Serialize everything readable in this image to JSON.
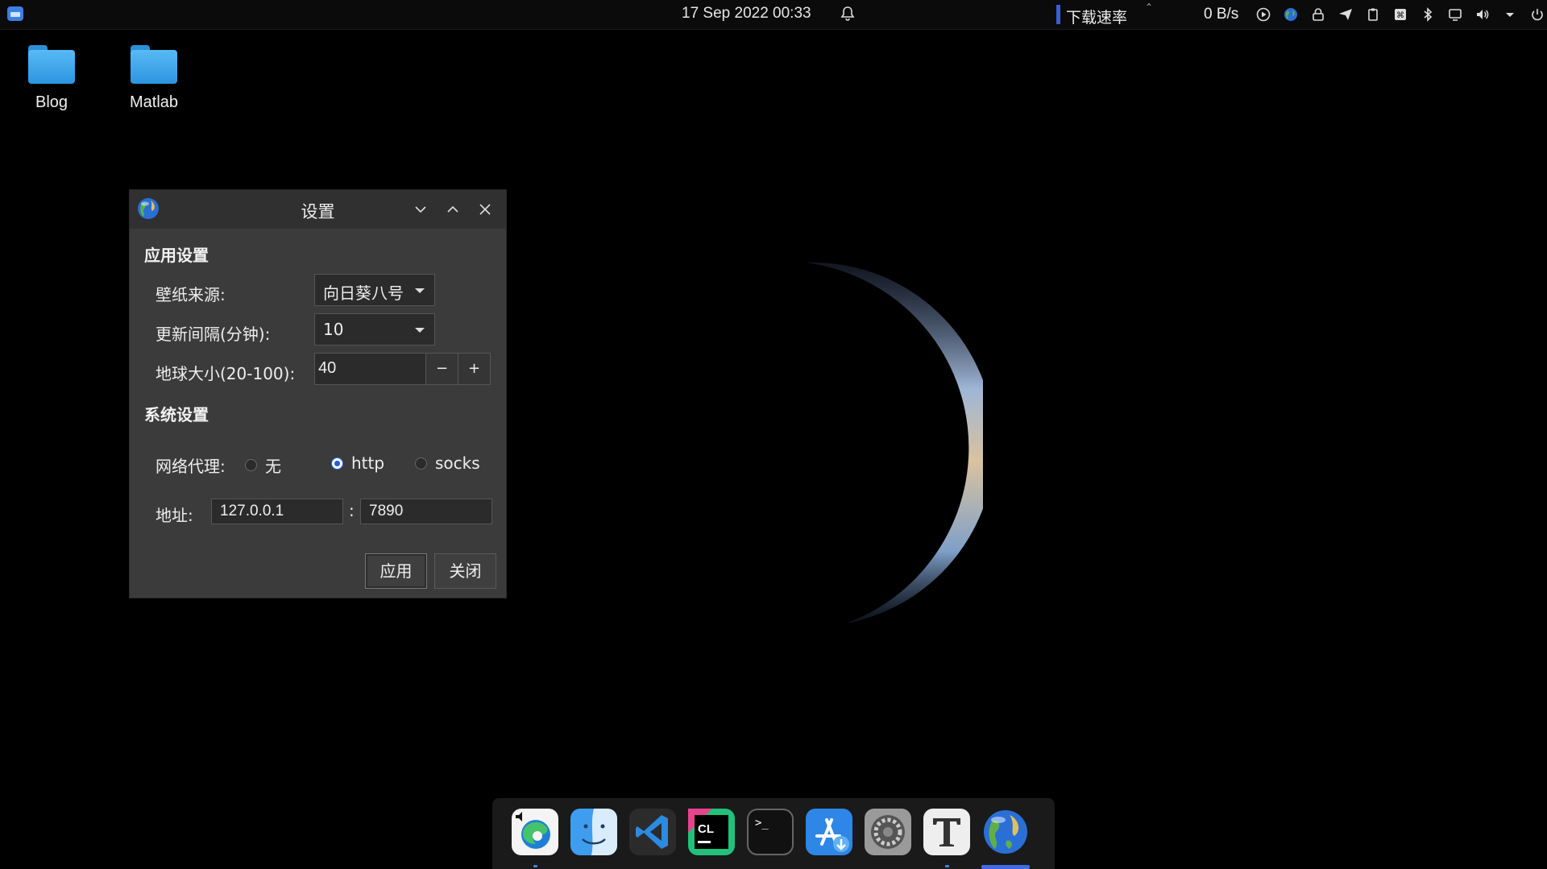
{
  "topbar": {
    "clock": "17 Sep 2022  00:33",
    "netspeed_label": "下载速率",
    "netspeed_value": "0 B/s",
    "tray_icons": [
      "play-circle-icon",
      "earth-icon",
      "lock-icon",
      "send-icon",
      "clipboard-icon",
      "command-icon",
      "bluetooth-icon",
      "display-icon",
      "volume-icon",
      "dropdown-icon",
      "power-icon"
    ]
  },
  "desktop": {
    "icons": [
      {
        "label": "Blog"
      },
      {
        "label": "Matlab"
      }
    ]
  },
  "settings_window": {
    "title": "设置",
    "app_section": "应用设置",
    "wallpaper_label": "壁纸来源:",
    "wallpaper_value": "向日葵八号",
    "interval_label": "更新间隔(分钟):",
    "interval_value": "10",
    "earth_size_label": "地球大小(20-100):",
    "earth_size_value": "40",
    "minus": "−",
    "plus": "+",
    "system_section": "系统设置",
    "proxy_label": "网络代理:",
    "proxy_options": [
      "无",
      "http",
      "socks"
    ],
    "proxy_selected": "http",
    "address_label": "地址:",
    "address_host": "127.0.0.1",
    "address_sep": ":",
    "address_port": "7890",
    "apply_label": "应用",
    "close_label": "关闭"
  },
  "dock": {
    "apps": [
      "edge-icon",
      "finder-icon",
      "vscode-icon",
      "clion-icon",
      "terminal-icon",
      "appstore-icon",
      "settings-icon",
      "typora-icon",
      "earth-wallpaper-icon"
    ],
    "colors": {
      "accent": "#3e6be6"
    }
  }
}
